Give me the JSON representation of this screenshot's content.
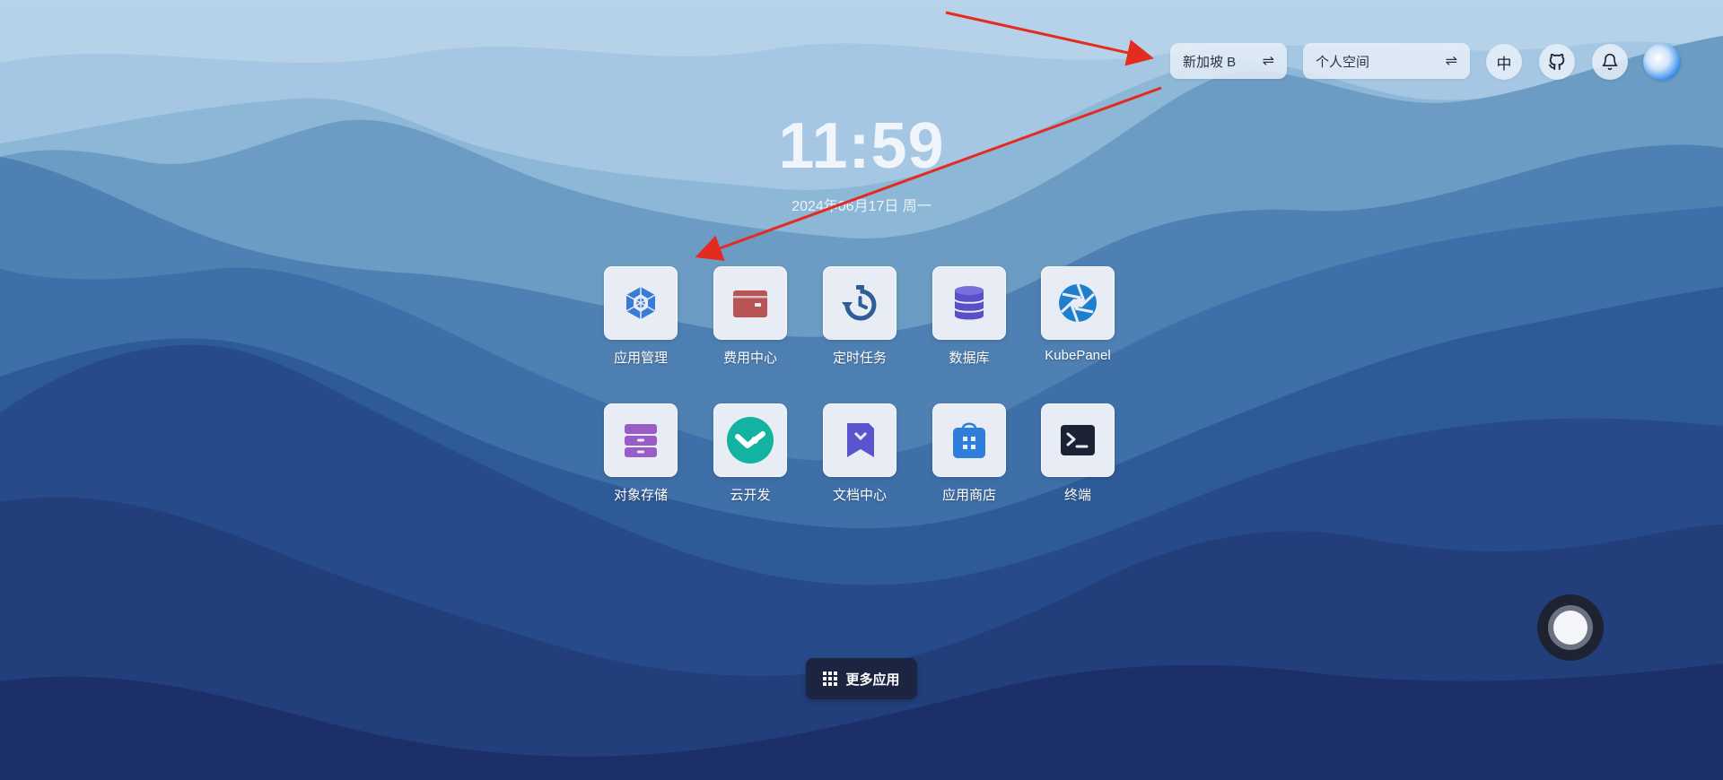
{
  "header": {
    "region_label": "新加坡 B",
    "workspace_label": "个人空间",
    "language_label": "中",
    "swap_glyph": "⇌"
  },
  "clock": {
    "time": "11:59",
    "date": "2024年06月17日 周一"
  },
  "apps": [
    {
      "label": "应用管理",
      "icon": "app-management-icon",
      "color": "#3a7bd5"
    },
    {
      "label": "费用中心",
      "icon": "wallet-icon",
      "color": "#b95454"
    },
    {
      "label": "定时任务",
      "icon": "stopwatch-icon",
      "color": "#2f5d97"
    },
    {
      "label": "数据库",
      "icon": "database-icon",
      "color": "#5b4fc8"
    },
    {
      "label": "KubePanel",
      "icon": "aperture-icon",
      "color": "#1f7fcf"
    },
    {
      "label": "对象存储",
      "icon": "storage-drawer-icon",
      "color": "#9a5cc6"
    },
    {
      "label": "云开发",
      "icon": "cloud-dev-icon",
      "color": "#12b3a0"
    },
    {
      "label": "文档中心",
      "icon": "document-bookmark-icon",
      "color": "#5a55cf"
    },
    {
      "label": "应用商店",
      "icon": "app-store-bag-icon",
      "color": "#2f7ed9"
    },
    {
      "label": "终端",
      "icon": "terminal-icon",
      "color": "#1b2233"
    }
  ],
  "more_apps": {
    "label": "更多应用",
    "icon": "grid-icon"
  },
  "colors": {
    "annotation_arrow": "#e32b1f",
    "accent": "#3a7bd5"
  }
}
